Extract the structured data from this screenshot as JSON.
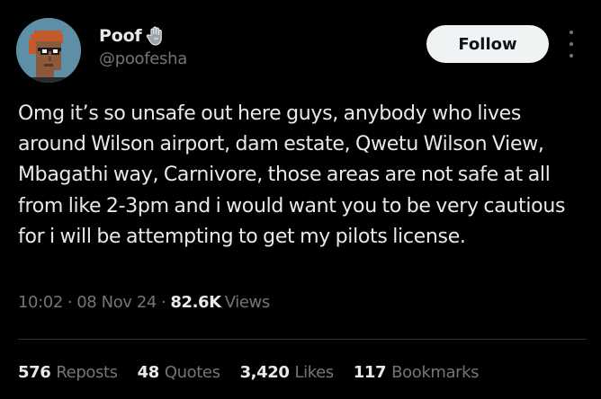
{
  "author": {
    "display_name": "Poof",
    "handle": "@poofesha",
    "badge_icon": "raised-hand-icon",
    "avatar_icon": "pixel-punk-avatar"
  },
  "actions": {
    "follow_label": "Follow",
    "more_icon": "vertical-ellipsis-icon"
  },
  "tweet": {
    "text": "Omg it’s so unsafe out here guys, anybody who lives around Wilson airport, dam estate, Qwetu Wilson View, Mbagathi way, Carnivore, those areas are not safe at all from like 2-3pm and i would want you to be very cautious for i will be attempting to get my pilots license."
  },
  "meta": {
    "time": "10:02",
    "date": "08 Nov 24",
    "views_count": "82.6K",
    "views_label": "Views",
    "separator": "·"
  },
  "stats": [
    {
      "count": "576",
      "label": "Reposts"
    },
    {
      "count": "48",
      "label": "Quotes"
    },
    {
      "count": "3,420",
      "label": "Likes"
    },
    {
      "count": "117",
      "label": "Bookmarks"
    }
  ],
  "colors": {
    "background": "#000000",
    "primary_text": "#e7e9ea",
    "secondary_text": "#71767b",
    "follow_button_bg": "#eff3f4",
    "follow_button_text": "#0f1419",
    "divider": "#2f3336"
  }
}
